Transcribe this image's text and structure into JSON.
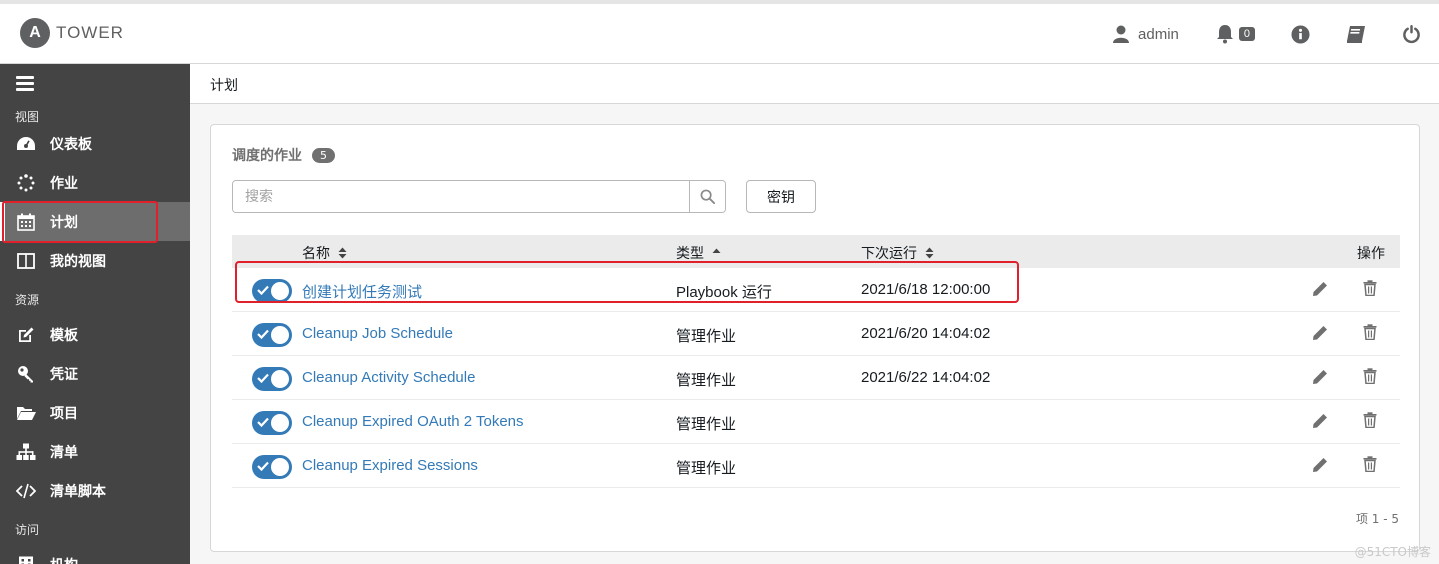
{
  "app": {
    "logo_letter": "A",
    "logo_text": "TOWER"
  },
  "topbar": {
    "user": "admin",
    "notification_count": "0"
  },
  "sidebar": {
    "sections": [
      {
        "label": "视图"
      },
      {
        "label": "资源"
      },
      {
        "label": "访问"
      }
    ],
    "items": [
      {
        "label": "仪表板",
        "icon": "tachometer-icon"
      },
      {
        "label": "作业",
        "icon": "spinner-icon"
      },
      {
        "label": "计划",
        "icon": "calendar-icon",
        "active": true
      },
      {
        "label": "我的视图",
        "icon": "columns-icon"
      },
      {
        "label": "模板",
        "icon": "edit-icon"
      },
      {
        "label": "凭证",
        "icon": "key-icon"
      },
      {
        "label": "项目",
        "icon": "folder-open-icon"
      },
      {
        "label": "清单",
        "icon": "sitemap-icon"
      },
      {
        "label": "清单脚本",
        "icon": "code-icon"
      },
      {
        "label": "机构",
        "icon": "building-icon"
      }
    ]
  },
  "breadcrumb": "计划",
  "panel": {
    "title": "调度的作业",
    "count": "5",
    "search_placeholder": "搜索",
    "key_button": "密钥",
    "columns": {
      "name": "名称",
      "type": "类型",
      "next_run": "下次运行",
      "actions": "操作"
    },
    "rows": [
      {
        "name": "创建计划任务测试",
        "type": "Playbook 运行",
        "next_run": "2021/6/18 12:00:00",
        "enabled": true
      },
      {
        "name": "Cleanup Job Schedule",
        "type": "管理作业",
        "next_run": "2021/6/20 14:04:02",
        "enabled": true
      },
      {
        "name": "Cleanup Activity Schedule",
        "type": "管理作业",
        "next_run": "2021/6/22 14:04:02",
        "enabled": true
      },
      {
        "name": "Cleanup Expired OAuth 2 Tokens",
        "type": "管理作业",
        "next_run": "",
        "enabled": true
      },
      {
        "name": "Cleanup Expired Sessions",
        "type": "管理作业",
        "next_run": "",
        "enabled": true
      }
    ],
    "pager": "项 1 - 5"
  },
  "watermark": "@51CTO博客",
  "colors": {
    "accent": "#337ab7",
    "sidebar": "#444444",
    "highlight": "#e0202b"
  }
}
